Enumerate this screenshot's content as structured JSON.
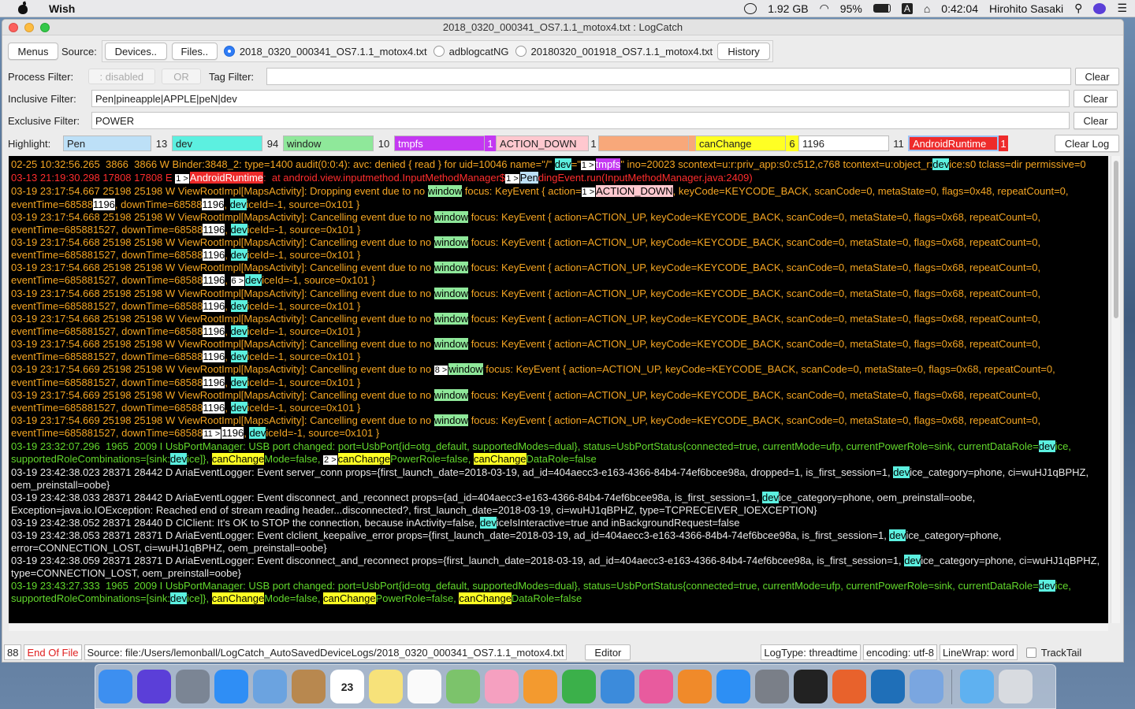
{
  "menubar": {
    "app_name": "Wish",
    "memory": "1.92 GB",
    "battery": "95%",
    "input_indicator": "A",
    "clock": "0:42:04",
    "user": "Hirohito Sasaki"
  },
  "window": {
    "title": "2018_0320_000341_OS7.1.1_motox4.txt : LogCatch"
  },
  "toolbar": {
    "menus": "Menus",
    "source_label": "Source:",
    "devices": "Devices..",
    "files": "Files..",
    "sources": [
      {
        "label": "2018_0320_000341_OS7.1.1_motox4.txt",
        "selected": true
      },
      {
        "label": "adblogcatNG",
        "selected": false
      },
      {
        "label": "20180320_001918_OS7.1.1_motox4.txt",
        "selected": false
      }
    ],
    "history": "History"
  },
  "filters": {
    "process_label": "Process Filter:",
    "process_placeholder": ": disabled",
    "or_label": "OR",
    "tag_label": "Tag Filter:",
    "tag_value": "",
    "inclusive_label": "Inclusive Filter:",
    "inclusive_value": "Pen|pineapple|APPLE|peN|dev",
    "exclusive_label": "Exclusive Filter:",
    "exclusive_value": "POWER",
    "clear": "Clear"
  },
  "highlight": {
    "label": "Highlight:",
    "items": [
      {
        "text": "Pen",
        "count": "13",
        "color": "#bde0f7"
      },
      {
        "text": "dev",
        "count": "94",
        "color": "#5cf0e0"
      },
      {
        "text": "window",
        "count": "10",
        "color": "#8fe89a"
      },
      {
        "text": "tmpfs",
        "count": "1",
        "color": "#c438f2"
      },
      {
        "text": "ACTION_DOWN",
        "count": "1",
        "color": "#ffc8cf"
      },
      {
        "text": "",
        "count": "",
        "color": "#f8a87a"
      },
      {
        "text": "canChange",
        "count": "6",
        "color": "#ffff24"
      },
      {
        "text": "1196",
        "count": "11",
        "color": "#ffffff"
      },
      {
        "text": "AndroidRuntime",
        "count": "1",
        "color": "#ee2b2b"
      }
    ],
    "clear_log": "Clear Log"
  },
  "log_lines": [
    {
      "color": "or",
      "segs": [
        [
          "02-25 10:32:56.265  3866  3866 W Binder:3848_2: type=1400 audit(0:0:4): avc: denied { read } for uid=10046 name=\"/\" ",
          ""
        ],
        [
          "dev",
          "dev"
        ],
        [
          "=\"",
          ""
        ],
        [
          "1 >",
          "mk"
        ],
        [
          "tmpfs",
          "tmp"
        ],
        [
          "\" ino=20023 scontext=u:r:priv_app:s0:c512,c768 tcontext=u:object_r:",
          ""
        ],
        [
          "dev",
          "dev"
        ],
        [
          "ice:s0 tclass=dir permissive=0",
          ""
        ]
      ]
    },
    {
      "color": "red",
      "segs": [
        [
          "03-13 21:19:30.298 17808 17808 E ",
          ""
        ],
        [
          "1 >",
          "mk"
        ],
        [
          "AndroidRuntime",
          "ar"
        ],
        [
          ":  at android.view.inputmethod.InputMethodManager$",
          ""
        ],
        [
          "1 >",
          "mk"
        ],
        [
          "Pen",
          "pen"
        ],
        [
          "dingEvent.run(InputMethodManager.java:2409)",
          ""
        ]
      ]
    },
    {
      "color": "or",
      "segs": [
        [
          "03-19 23:17:54.667 25198 25198 W ViewRootImpl[MapsActivity]: Dropping event due to no ",
          ""
        ],
        [
          "window",
          "win"
        ],
        [
          " focus: KeyEvent { action=",
          ""
        ],
        [
          "1 >",
          "mk"
        ],
        [
          "ACTION_DOWN",
          "act"
        ],
        [
          ", keyCode=KEYCODE_BACK, scanCode=0, metaState=0, flags=0x48, repeatCount=0, eventTime=68588",
          ""
        ],
        [
          "1196",
          "num"
        ],
        [
          ", downTime=68588",
          ""
        ],
        [
          "1196",
          "num"
        ],
        [
          ", ",
          ""
        ],
        [
          "dev",
          "dev"
        ],
        [
          "iceId=-1, source=0x101 }",
          ""
        ]
      ]
    },
    {
      "color": "or",
      "segs": [
        [
          "03-19 23:17:54.668 25198 25198 W ViewRootImpl[MapsActivity]: Cancelling event due to no ",
          ""
        ],
        [
          "window",
          "win"
        ],
        [
          " focus: KeyEvent { action=ACTION_UP, keyCode=KEYCODE_BACK, scanCode=0, metaState=0, flags=0x68, repeatCount=0, eventTime=685881527, downTime=68588",
          ""
        ],
        [
          "1196",
          "num"
        ],
        [
          ", ",
          ""
        ],
        [
          "dev",
          "dev"
        ],
        [
          "iceId=-1, source=0x101 }",
          ""
        ]
      ]
    },
    {
      "color": "or",
      "segs": [
        [
          "03-19 23:17:54.668 25198 25198 W ViewRootImpl[MapsActivity]: Cancelling event due to no ",
          ""
        ],
        [
          "window",
          "win"
        ],
        [
          " focus: KeyEvent { action=ACTION_UP, keyCode=KEYCODE_BACK, scanCode=0, metaState=0, flags=0x68, repeatCount=0, eventTime=685881527, downTime=68588",
          ""
        ],
        [
          "1196",
          "num"
        ],
        [
          ", ",
          ""
        ],
        [
          "dev",
          "dev"
        ],
        [
          "iceId=-1, source=0x101 }",
          ""
        ]
      ]
    },
    {
      "color": "or",
      "segs": [
        [
          "03-19 23:17:54.668 25198 25198 W ViewRootImpl[MapsActivity]: Cancelling event due to no ",
          ""
        ],
        [
          "window",
          "win"
        ],
        [
          " focus: KeyEvent { action=ACTION_UP, keyCode=KEYCODE_BACK, scanCode=0, metaState=0, flags=0x68, repeatCount=0, eventTime=685881527, downTime=68588",
          ""
        ],
        [
          "1196",
          "num"
        ],
        [
          ", ",
          ""
        ],
        [
          "6 >",
          "mk"
        ],
        [
          "dev",
          "dev"
        ],
        [
          "iceId=-1, source=0x101 }",
          ""
        ]
      ]
    },
    {
      "color": "or",
      "segs": [
        [
          "03-19 23:17:54.668 25198 25198 W ViewRootImpl[MapsActivity]: Cancelling event due to no ",
          ""
        ],
        [
          "window",
          "win"
        ],
        [
          " focus: KeyEvent { action=ACTION_UP, keyCode=KEYCODE_BACK, scanCode=0, metaState=0, flags=0x68, repeatCount=0, eventTime=685881527, downTime=68588",
          ""
        ],
        [
          "1196",
          "num"
        ],
        [
          ", ",
          ""
        ],
        [
          "dev",
          "dev"
        ],
        [
          "iceId=-1, source=0x101 }",
          ""
        ]
      ]
    },
    {
      "color": "or",
      "segs": [
        [
          "03-19 23:17:54.668 25198 25198 W ViewRootImpl[MapsActivity]: Cancelling event due to no ",
          ""
        ],
        [
          "window",
          "win"
        ],
        [
          " focus: KeyEvent { action=ACTION_UP, keyCode=KEYCODE_BACK, scanCode=0, metaState=0, flags=0x68, repeatCount=0, eventTime=685881527, downTime=68588",
          ""
        ],
        [
          "1196",
          "num"
        ],
        [
          ", ",
          ""
        ],
        [
          "dev",
          "dev"
        ],
        [
          "iceId=-1, source=0x101 }",
          ""
        ]
      ]
    },
    {
      "color": "or",
      "segs": [
        [
          "03-19 23:17:54.668 25198 25198 W ViewRootImpl[MapsActivity]: Cancelling event due to no ",
          ""
        ],
        [
          "window",
          "win"
        ],
        [
          " focus: KeyEvent { action=ACTION_UP, keyCode=KEYCODE_BACK, scanCode=0, metaState=0, flags=0x68, repeatCount=0, eventTime=685881527, downTime=68588",
          ""
        ],
        [
          "1196",
          "num"
        ],
        [
          ", ",
          ""
        ],
        [
          "dev",
          "dev"
        ],
        [
          "iceId=-1, source=0x101 }",
          ""
        ]
      ]
    },
    {
      "color": "or",
      "segs": [
        [
          "03-19 23:17:54.669 25198 25198 W ViewRootImpl[MapsActivity]: Cancelling event due to no ",
          ""
        ],
        [
          "8 >",
          "mk"
        ],
        [
          "window",
          "win"
        ],
        [
          " focus: KeyEvent { action=ACTION_UP, keyCode=KEYCODE_BACK, scanCode=0, metaState=0, flags=0x68, repeatCount=0, eventTime=685881527, downTime=68588",
          ""
        ],
        [
          "1196",
          "num"
        ],
        [
          ", ",
          ""
        ],
        [
          "dev",
          "dev"
        ],
        [
          "iceId=-1, source=0x101 }",
          ""
        ]
      ]
    },
    {
      "color": "or",
      "segs": [
        [
          "03-19 23:17:54.669 25198 25198 W ViewRootImpl[MapsActivity]: Cancelling event due to no ",
          ""
        ],
        [
          "window",
          "win"
        ],
        [
          " focus: KeyEvent { action=ACTION_UP, keyCode=KEYCODE_BACK, scanCode=0, metaState=0, flags=0x68, repeatCount=0, eventTime=685881527, downTime=68588",
          ""
        ],
        [
          "1196",
          "num"
        ],
        [
          ", ",
          ""
        ],
        [
          "dev",
          "dev"
        ],
        [
          "iceId=-1, source=0x101 }",
          ""
        ]
      ]
    },
    {
      "color": "or",
      "segs": [
        [
          "03-19 23:17:54.669 25198 25198 W ViewRootImpl[MapsActivity]: Cancelling event due to no ",
          ""
        ],
        [
          "window",
          "win"
        ],
        [
          " focus: KeyEvent { action=ACTION_UP, keyCode=KEYCODE_BACK, scanCode=0, metaState=0, flags=0x68, repeatCount=0, eventTime=685881527, downTime=68588",
          ""
        ],
        [
          "11 >",
          "mk"
        ],
        [
          "1196",
          "num"
        ],
        [
          ", ",
          ""
        ],
        [
          "dev",
          "dev"
        ],
        [
          "iceId=-1, source=0x101 }",
          ""
        ]
      ]
    },
    {
      "color": "grn",
      "segs": [
        [
          "03-19 23:32:07.296  1965  2009 I UsbPortManager: USB port changed: port=UsbPort{id=otg_default, supportedModes=dual}, status=UsbPortStatus{connected=true, currentMode=ufp, currentPowerRole=sink, currentDataRole=",
          ""
        ],
        [
          "dev",
          "dev"
        ],
        [
          "ice, supportedRoleCombinations=[sink:",
          ""
        ],
        [
          "dev",
          "dev"
        ],
        [
          "ice]}, ",
          ""
        ],
        [
          "canChange",
          "cc"
        ],
        [
          "Mode=false, ",
          ""
        ],
        [
          "2 >",
          "mk"
        ],
        [
          "canChange",
          "cc"
        ],
        [
          "PowerRole=false, ",
          ""
        ],
        [
          "canChange",
          "cc"
        ],
        [
          "DataRole=false",
          ""
        ]
      ]
    },
    {
      "color": "wht",
      "segs": [
        [
          "03-19 23:42:38.023 28371 28442 D AriaEventLogger: Event server_conn props={first_launch_date=2018-03-19, ad_id=404aecc3-e163-4366-84b4-74ef6bcee98a, dropped=1, is_first_session=1, ",
          ""
        ],
        [
          "dev",
          "dev"
        ],
        [
          "ice_category=phone, ci=wuHJ1qBPHZ, oem_preinstall=oobe}",
          ""
        ]
      ]
    },
    {
      "color": "wht",
      "segs": [
        [
          "03-19 23:42:38.033 28371 28442 D AriaEventLogger: Event disconnect_and_reconnect props={ad_id=404aecc3-e163-4366-84b4-74ef6bcee98a, is_first_session=1, ",
          ""
        ],
        [
          "dev",
          "dev"
        ],
        [
          "ice_category=phone, oem_preinstall=oobe, Exception=java.io.IOException: Reached end of stream reading header...disconnected?, first_launch_date=2018-03-19, ci=wuHJ1qBPHZ, type=TCPRECEIVER_IOEXCEPTION}",
          ""
        ]
      ]
    },
    {
      "color": "wht",
      "segs": [
        [
          "03-19 23:42:38.052 28371 28440 D ClClient: It's OK to STOP the connection, because inActivity=false, ",
          ""
        ],
        [
          "dev",
          "dev"
        ],
        [
          "iceIsInteractive=true and inBackgroundRequest=false",
          ""
        ]
      ]
    },
    {
      "color": "wht",
      "segs": [
        [
          "03-19 23:42:38.053 28371 28371 D AriaEventLogger: Event clclient_keepalive_error props={first_launch_date=2018-03-19, ad_id=404aecc3-e163-4366-84b4-74ef6bcee98a, is_first_session=1, ",
          ""
        ],
        [
          "dev",
          "dev"
        ],
        [
          "ice_category=phone, error=CONNECTION_LOST, ci=wuHJ1qBPHZ, oem_preinstall=oobe}",
          ""
        ]
      ]
    },
    {
      "color": "wht",
      "segs": [
        [
          "03-19 23:42:38.059 28371 28371 D AriaEventLogger: Event disconnect_and_reconnect props={first_launch_date=2018-03-19, ad_id=404aecc3-e163-4366-84b4-74ef6bcee98a, is_first_session=1, ",
          ""
        ],
        [
          "dev",
          "dev"
        ],
        [
          "ice_category=phone, ci=wuHJ1qBPHZ, type=CONNECTION_LOST, oem_preinstall=oobe}",
          ""
        ]
      ]
    },
    {
      "color": "grn",
      "segs": [
        [
          "03-19 23:43:27.333  1965  2009 I UsbPortManager: USB port changed: port=UsbPort{id=otg_default, supportedModes=dual}, status=UsbPortStatus{connected=true, currentMode=ufp, currentPowerRole=sink, currentDataRole=",
          ""
        ],
        [
          "dev",
          "dev"
        ],
        [
          "ice, supportedRoleCombinations=[sink:",
          ""
        ],
        [
          "dev",
          "dev"
        ],
        [
          "ice]}, ",
          ""
        ],
        [
          "canChange",
          "cc"
        ],
        [
          "Mode=false, ",
          ""
        ],
        [
          "canChange",
          "cc"
        ],
        [
          "PowerRole=false, ",
          ""
        ],
        [
          "canChange",
          "cc"
        ],
        [
          "DataRole=false",
          ""
        ]
      ]
    }
  ],
  "statusbar": {
    "line_count": "88",
    "end_of_file": "End Of File",
    "source": "Source: file:/Users/lemonball/LogCatch_AutoSavedDeviceLogs/2018_0320_000341_OS7.1.1_motox4.txt",
    "editor": "Editor",
    "logtype": "LogType: threadtime",
    "encoding": "encoding: utf-8",
    "linewrap": "LineWrap: word",
    "tracktail": "TrackTail"
  },
  "dock": {
    "items": [
      {
        "icon": "finder-icon",
        "color": "#3d8ff0"
      },
      {
        "icon": "siri-icon",
        "color": "#5b3fd8"
      },
      {
        "icon": "launchpad-icon",
        "color": "#7b8594"
      },
      {
        "icon": "safari-icon",
        "color": "#2f8ef5"
      },
      {
        "icon": "mail-icon",
        "color": "#6ba3e0"
      },
      {
        "icon": "contacts-icon",
        "color": "#b8884f"
      },
      {
        "icon": "calendar-icon",
        "color": "#ffffff",
        "text": "23"
      },
      {
        "icon": "notes-icon",
        "color": "#f7e27a"
      },
      {
        "icon": "reminders-icon",
        "color": "#fafafa"
      },
      {
        "icon": "maps-icon",
        "color": "#7cc36b"
      },
      {
        "icon": "photos-icon",
        "color": "#f5a0c0"
      },
      {
        "icon": "pages-icon",
        "color": "#f39a2f"
      },
      {
        "icon": "numbers-icon",
        "color": "#3bb04a"
      },
      {
        "icon": "keynote-icon",
        "color": "#3c8bdb"
      },
      {
        "icon": "itunes-icon",
        "color": "#e85b9e"
      },
      {
        "icon": "ibooks-icon",
        "color": "#f08a2a"
      },
      {
        "icon": "appstore-icon",
        "color": "#2d8ff4"
      },
      {
        "icon": "system-preferences-icon",
        "color": "#7a7f88"
      },
      {
        "icon": "terminal-icon",
        "color": "#222222"
      },
      {
        "icon": "firefox-icon",
        "color": "#e8622c"
      },
      {
        "icon": "vscode-icon",
        "color": "#1f6fb8"
      },
      {
        "icon": "feather-icon",
        "color": "#7aa6e0"
      },
      {
        "icon": "downloads-folder-icon",
        "color": "#5fb1f0"
      },
      {
        "icon": "trash-icon",
        "color": "#d8dbe0"
      }
    ]
  }
}
